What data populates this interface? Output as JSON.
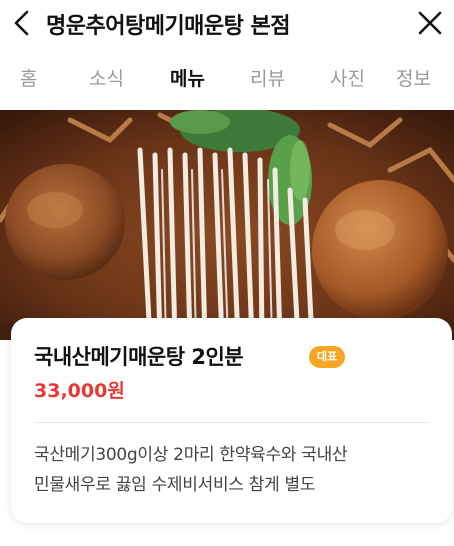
{
  "header": {
    "title": "명운추어탕메기매운탕 본점",
    "back_icon": "chevron-left-icon",
    "close_icon": "close-icon"
  },
  "tabs": [
    {
      "label": "홈",
      "active": false
    },
    {
      "label": "소식",
      "active": false
    },
    {
      "label": "메뉴",
      "active": true
    },
    {
      "label": "리뷰",
      "active": false
    },
    {
      "label": "사진",
      "active": false
    },
    {
      "label": "정보",
      "active": false
    }
  ],
  "menu_item": {
    "name": "국내산메기매운탕 2인분",
    "badge": "대표",
    "price": "33,000원",
    "description_lines": [
      "국산메기300g이상 2마리 한약육수와 국내산",
      "민물새우로 끓임 수제비서비스 참게 별도"
    ]
  },
  "colors": {
    "accent_price": "#e53935",
    "badge_bg": "#f5a623",
    "tab_active": "#111111",
    "tab_inactive": "#9a9a9a"
  }
}
